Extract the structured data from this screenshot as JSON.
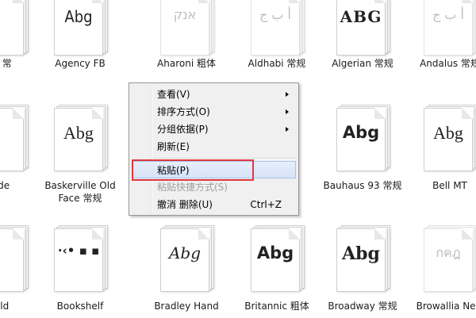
{
  "fonts": [
    {
      "row": 0,
      "col": 0,
      "label": "m 常",
      "sample": "",
      "faded": false
    },
    {
      "row": 0,
      "col": 1,
      "label": "Agency FB",
      "sample": "Abg",
      "faded": false
    },
    {
      "row": 0,
      "col": 2,
      "label": "Aharoni 粗体",
      "sample": "אנק",
      "faded": true
    },
    {
      "row": 0,
      "col": 3,
      "label": "Aldhabi 常规",
      "sample": "أ ب ج",
      "faded": true
    },
    {
      "row": 0,
      "col": 4,
      "label": "Algerian 常规",
      "sample": "ABG",
      "faded": false
    },
    {
      "row": 0,
      "col": 5,
      "label": "Andalus 常规",
      "sample": "أ ب ج",
      "faded": true
    },
    {
      "row": 1,
      "col": 0,
      "label": "ode",
      "sample": "",
      "faded": false
    },
    {
      "row": 1,
      "col": 1,
      "label": "Baskerville Old Face 常规",
      "sample": "Abg",
      "faded": false
    },
    {
      "row": 1,
      "col": 4,
      "label": "Bauhaus 93 常规",
      "sample": "Abg",
      "faded": false
    },
    {
      "row": 1,
      "col": 5,
      "label": "Bell MT",
      "sample": "Abg",
      "faded": false
    },
    {
      "row": 2,
      "col": 0,
      "label": "Old",
      "sample": "",
      "faded": false
    },
    {
      "row": 2,
      "col": 1,
      "label": "Bookshelf",
      "sample": "·‹• ▪ ▪",
      "faded": false
    },
    {
      "row": 2,
      "col": 2,
      "label": "Bradley Hand",
      "sample": "Abg",
      "faded": false
    },
    {
      "row": 2,
      "col": 3,
      "label": "Britannic 粗体",
      "sample": "Abg",
      "faded": false
    },
    {
      "row": 2,
      "col": 4,
      "label": "Broadway 常规",
      "sample": "Abg",
      "faded": false
    },
    {
      "row": 2,
      "col": 5,
      "label": "Browallia New",
      "sample": "กคฎ",
      "faded": true
    }
  ],
  "context_menu": {
    "items": [
      {
        "label": "查看(V)",
        "submenu": true,
        "disabled": false,
        "shortcut": ""
      },
      {
        "label": "排序方式(O)",
        "submenu": true,
        "disabled": false,
        "shortcut": ""
      },
      {
        "label": "分组依据(P)",
        "submenu": true,
        "disabled": false,
        "shortcut": ""
      },
      {
        "label": "刷新(E)",
        "submenu": false,
        "disabled": false,
        "shortcut": ""
      },
      {
        "label": "粘贴(P)",
        "submenu": false,
        "disabled": false,
        "shortcut": "",
        "highlighted": true
      },
      {
        "label": "粘贴快捷方式(S)",
        "submenu": false,
        "disabled": true,
        "shortcut": ""
      },
      {
        "label": "撤消 删除(U)",
        "submenu": false,
        "disabled": false,
        "shortcut": "Ctrl+Z"
      }
    ]
  },
  "colors": {
    "highlight_border": "#e0393e",
    "menu_bg": "#f0f0f0",
    "hover_border": "#a8c3ea"
  }
}
